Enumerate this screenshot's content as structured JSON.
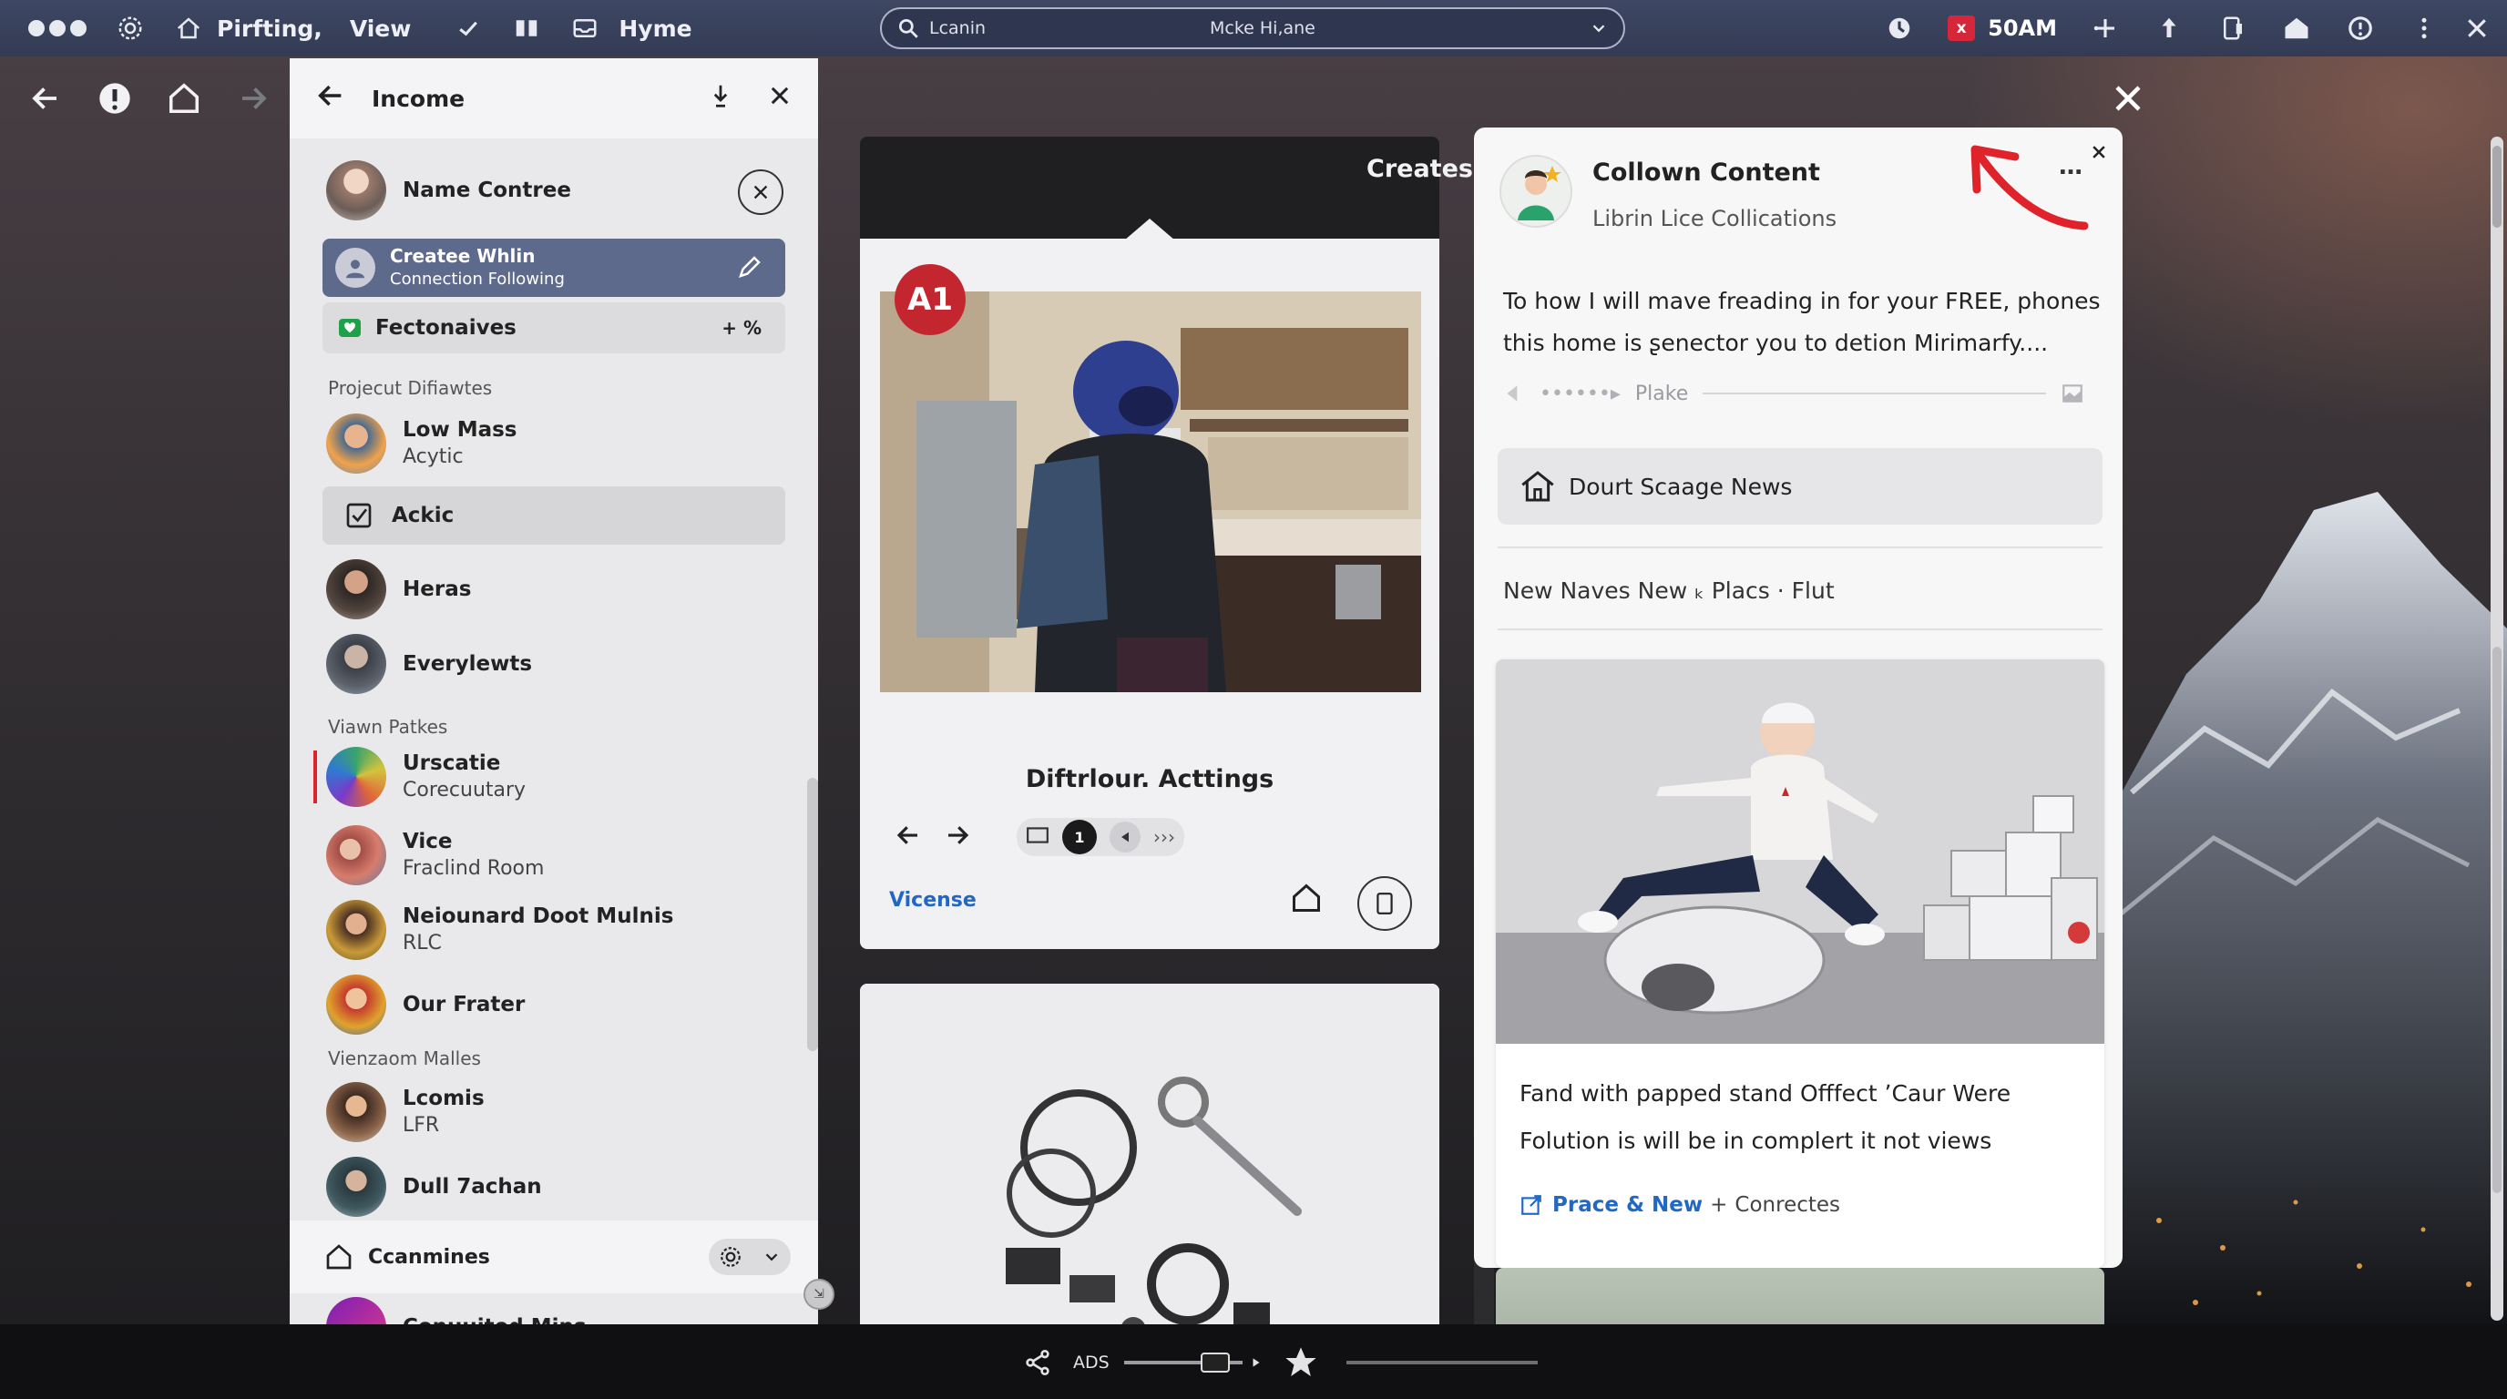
{
  "topbar": {
    "app_name": "Pirfting,",
    "menu_view": "View",
    "menu_hyme": "Hyme",
    "search_left": "Lcanin",
    "search_center": "Mcke Hi,ane",
    "badge": "x",
    "time": "50AM"
  },
  "sidebar": {
    "title": "Income",
    "profile_name": "Name Contree",
    "selected_title": "Createe Whlin",
    "selected_sub": "Connection Following",
    "favorites_label": "Fectonaives",
    "favorites_meta": "+ %",
    "section1": "Projecut Difiawtes",
    "item_low_mass": "Low Mass",
    "item_low_mass_sub": "Acytic",
    "item_ackic": "Ackic",
    "item_heras": "Heras",
    "item_everylewts": "Everylewts",
    "section2": "Viawn Patkes",
    "item_urscatie": "Urscatie",
    "item_urscatie_sub": "Corecuutary",
    "item_vice": "Vice",
    "item_vice_sub": "Fraclind Room",
    "item_neiounard": "Neiounard Doot Mulnis",
    "item_neiounard_sub": "RLC",
    "item_our_frater": "Our Frater",
    "section3": "Vienzaom Malles",
    "item_lcomis": "Lcomis",
    "item_lcomis_sub": "LFR",
    "item_dull": "Dull 7achan",
    "footer_label": "Ccanmines",
    "footer_next": "Conuuited Mins"
  },
  "main": {
    "header": "Creates",
    "card_badge": "A1",
    "card_title": "Diftrlour. Acttings",
    "page_indicator": "1",
    "more_glyph": "›››",
    "link": "Vicense"
  },
  "panel": {
    "title": "Collown Content",
    "subtitle": "Librin Lice Collications",
    "more_glyph": "…",
    "body_line1": "To how I will mave freading in for your FREE, phones",
    "body_line2": "this home is ʂenector you to detion Mirimarfy....",
    "dots_text": "••••••▸",
    "plake": "Plake",
    "news_button": "Dourt Scaage News",
    "tags": "New Naves New ₖ Placs · Flut",
    "caption1": "Fand with papped stand Offfect ʼCaur Were",
    "caption2": "Folution is will be in complert it not views",
    "link_label": "Prace & New",
    "link_plus": "+",
    "link_rest": "Conrectes"
  },
  "bottombar": {
    "label": "ADS"
  },
  "colors": {
    "accent_blue": "#2168c4",
    "badge_red": "#c3262e",
    "topbar": "#3b4460",
    "selected_row": "#5e6a8b",
    "annotation_red": "#e0232b"
  }
}
